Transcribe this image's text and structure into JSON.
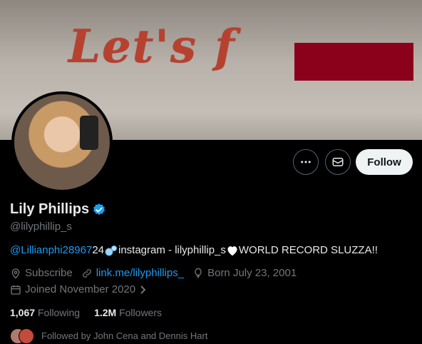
{
  "banner": {
    "text": "Let's f",
    "redaction_color": "#8b001a"
  },
  "profile": {
    "display_name": "Lily Phillips",
    "handle": "@lilyphillip_s",
    "verified_color": "#1d9bf0",
    "bio": {
      "mention": "@Lillianphi28967",
      "text_1": " 24",
      "text_2": " instagram - lilyphillip_s ",
      "text_3": " WORLD RECORD SLUZZA!!"
    },
    "meta": {
      "subscribe": "Subscribe",
      "link": "link.me/lilyphillips_",
      "born": "Born July 23, 2001",
      "joined": "Joined November 2020"
    },
    "stats": {
      "following_count": "1,067",
      "following_label": "Following",
      "followers_count": "1.2M",
      "followers_label": "Followers"
    },
    "followed_by": "Followed by John Cena and Dennis Hart"
  },
  "actions": {
    "more_icon": "more-horizontal-icon",
    "message_icon": "envelope-icon",
    "follow_label": "Follow"
  },
  "colors": {
    "accent": "#1d9bf0",
    "background": "#000000",
    "secondary_text": "#71767b"
  }
}
